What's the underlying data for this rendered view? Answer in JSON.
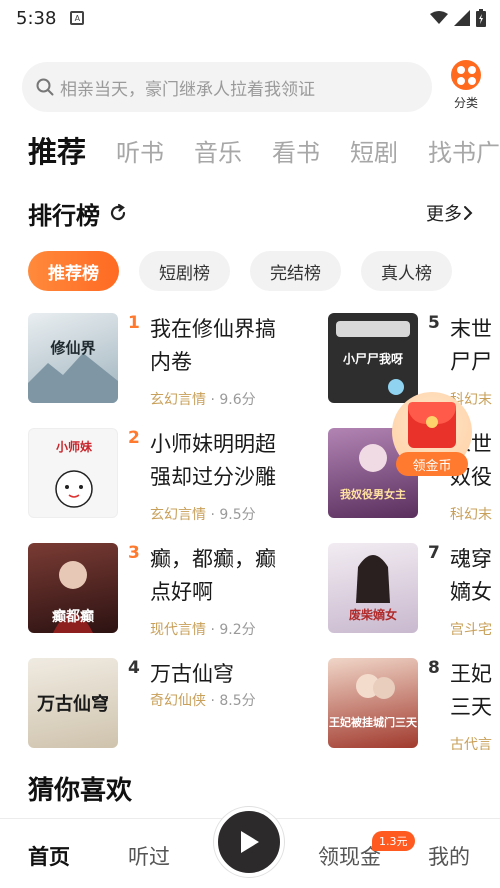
{
  "status_bar": {
    "time": "5:38",
    "app_icon": "A"
  },
  "search": {
    "placeholder": "相亲当天，豪门继承人拉着我领证",
    "category_label": "分类"
  },
  "tabs": [
    {
      "label": "推荐",
      "active": true
    },
    {
      "label": "听书"
    },
    {
      "label": "音乐"
    },
    {
      "label": "看书"
    },
    {
      "label": "短剧"
    },
    {
      "label": "找书广"
    }
  ],
  "ranking": {
    "title": "排行榜",
    "more_label": "更多",
    "chips": [
      "推荐榜",
      "短剧榜",
      "完结榜",
      "真人榜"
    ],
    "books": [
      {
        "rank": "1",
        "title": "我在修仙界搞内卷",
        "genre": "玄幻言情",
        "score": "· 9.6分",
        "cover_text": "修仙界",
        "cover_bg": "#cfd8dc"
      },
      {
        "rank": "2",
        "title": "小师妹明明超强却过分沙雕",
        "genre": "玄幻言情",
        "score": "· 9.5分",
        "cover_text": "小师妹",
        "cover_bg": "#f4f4f4"
      },
      {
        "rank": "3",
        "title": "癫，都癫，癫点好啊",
        "genre": "现代言情",
        "score": "· 9.2分",
        "cover_text": "癫都癫",
        "cover_bg": "#5a2a2a"
      },
      {
        "rank": "4",
        "title": "万古仙穹",
        "genre": "奇幻仙侠",
        "score": "· 8.5分",
        "cover_text": "万古仙穹",
        "cover_bg": "#e8e2d6"
      },
      {
        "rank": "5",
        "title": "末世",
        "genre": "科幻末",
        "score": "",
        "line2": "尸尸",
        "cover_text": "小尸尸我呀",
        "cover_bg": "#2e2e2e"
      },
      {
        "rank": "6",
        "title": "末世",
        "genre": "科幻末",
        "score": "",
        "line2": "奴役",
        "cover_text": "我奴役男女主",
        "cover_bg": "#8a5a8a"
      },
      {
        "rank": "7",
        "title": "魂穿",
        "genre": "宫斗宅",
        "score": "",
        "line2": "嫡女",
        "cover_text": "废柴嫡女",
        "cover_bg": "#e6dfe8"
      },
      {
        "rank": "8",
        "title": "王妃",
        "genre": "古代言",
        "score": "",
        "line2": "三天",
        "cover_text": "王妃被挂城门三天",
        "cover_bg": "#c85a4a"
      }
    ]
  },
  "floating_reward": {
    "label": "领金币"
  },
  "guess_section": {
    "title": "猜你喜欢"
  },
  "bottom_nav": {
    "items": [
      "首页",
      "听过",
      "领现金",
      "我的"
    ],
    "badge": "1.3元"
  },
  "colors": {
    "accent": "#ff6a22",
    "rank_top": "#ff7a2e",
    "rank_other": "#333333",
    "genre": "#c8a05a"
  }
}
